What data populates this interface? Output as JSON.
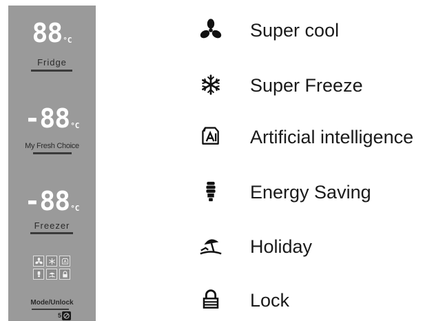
{
  "panel": {
    "zones": [
      {
        "id": "fridge",
        "display": "88",
        "unit": "°C",
        "label": "Fridge"
      },
      {
        "id": "my-fresh-choice",
        "display": "-88",
        "unit": "°C",
        "label": "My Fresh Choice"
      },
      {
        "id": "freezer",
        "display": "-88",
        "unit": "°C",
        "label": "Freezer"
      }
    ],
    "mini_icons": [
      "fan-icon",
      "snowflake-icon",
      "ai-icon",
      "bulb-icon",
      "umbrella-icon",
      "lock-icon"
    ],
    "mode_button": {
      "label": "Mode/Unlock",
      "hold": "5"
    }
  },
  "legend": [
    {
      "icon": "fan-icon",
      "label": "Super cool"
    },
    {
      "icon": "snowflake-icon",
      "label": "Super Freeze"
    },
    {
      "icon": "ai-icon",
      "label": "Artificial intelligence"
    },
    {
      "icon": "energy-bulb-icon",
      "label": "Energy Saving"
    },
    {
      "icon": "beach-umbrella-icon",
      "label": "Holiday"
    },
    {
      "icon": "lock-icon",
      "label": "Lock"
    }
  ],
  "colors": {
    "panel_bg": "#9a9a9a",
    "segment": "#ffffff",
    "text": "#1a1a1a"
  }
}
